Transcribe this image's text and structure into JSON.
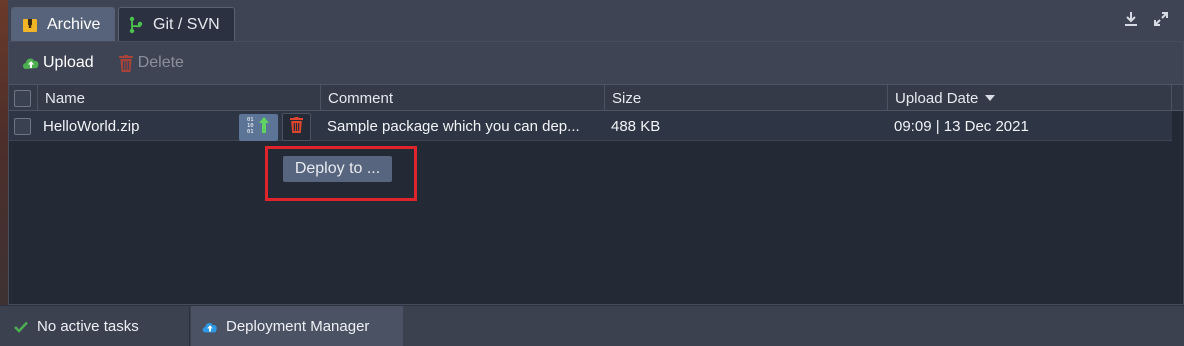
{
  "tabs": {
    "archive": {
      "label": "Archive",
      "icon": "archive-icon",
      "active": true
    },
    "git": {
      "label": "Git / SVN",
      "icon": "git-branch-icon",
      "active": false
    }
  },
  "top_right": {
    "icons": [
      "download-icon",
      "expand-icon"
    ]
  },
  "toolbar": {
    "upload_label": "Upload",
    "upload_icon": "cloud-upload-icon",
    "delete_label": "Delete",
    "delete_icon": "trash-icon"
  },
  "table": {
    "columns": {
      "name": "Name",
      "comment": "Comment",
      "size": "Size",
      "upload_date": "Upload Date"
    },
    "sort_column": "upload_date",
    "sort_direction": "desc",
    "rows": [
      {
        "name": "HelloWorld.zip",
        "comment": "Sample package which you can dep...",
        "size": "488 KB",
        "upload_date": "09:09 | 13 Dec 2021"
      }
    ]
  },
  "tooltip": {
    "text": "Deploy to ..."
  },
  "statusbar": {
    "tasks_label": "No active tasks",
    "tasks_icon": "checkmark-icon",
    "deployment_label": "Deployment Manager",
    "deployment_icon": "cloud-icon"
  },
  "colors": {
    "accent_blue": "#5c7596",
    "highlight_red": "#e0242b",
    "upload_green": "#4caf50",
    "delete_red": "#c0392b"
  }
}
